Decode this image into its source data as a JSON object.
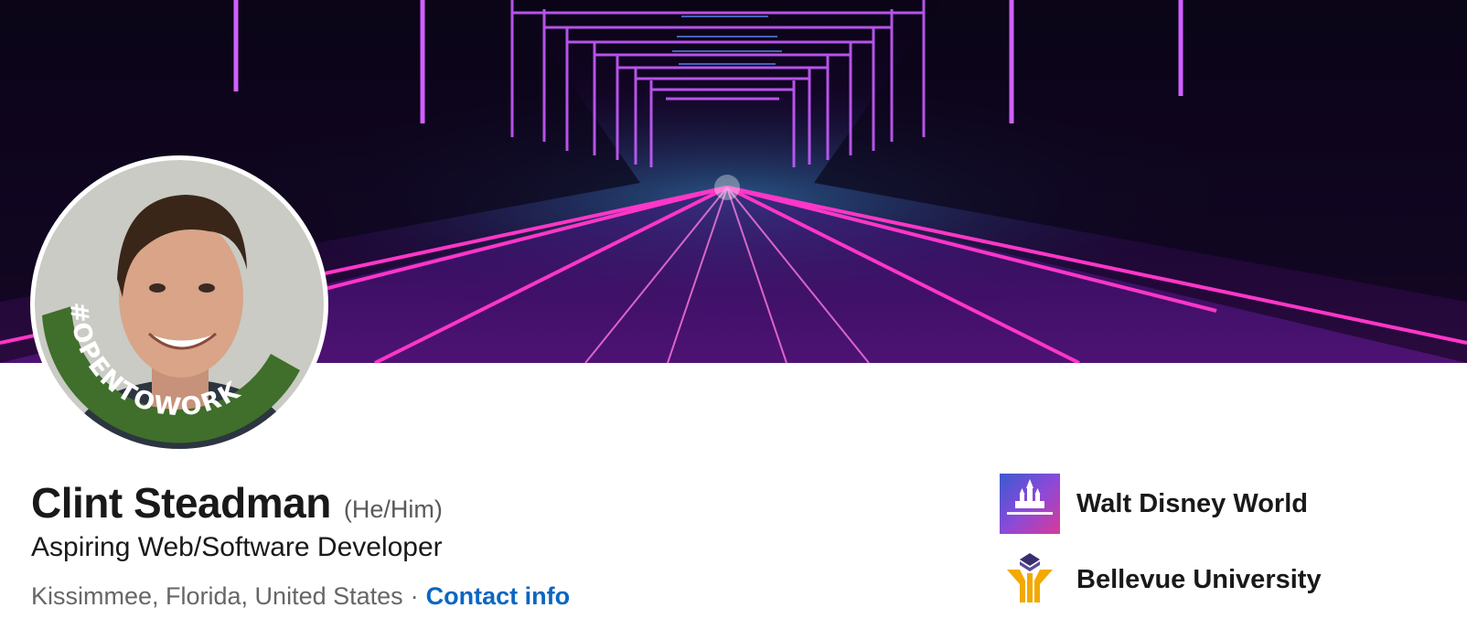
{
  "profile": {
    "name": "Clint Steadman",
    "pronouns": "(He/Him)",
    "headline": "Aspiring Web/Software Developer",
    "location": "Kissimmee, Florida, United States",
    "separator": "·",
    "contact_label": "Contact info",
    "open_to_work_frame": "#OPENTOWORK"
  },
  "affiliations": [
    {
      "label": "Walt Disney World",
      "logo": "disney-castle-logo"
    },
    {
      "label": "Bellevue University",
      "logo": "bellevue-university-logo"
    }
  ],
  "colors": {
    "accent_link": "#0a66c2",
    "open_to_work_green": "#3f6f2a",
    "neon_pink": "#ff2fc4",
    "neon_purple": "#a040ff"
  }
}
